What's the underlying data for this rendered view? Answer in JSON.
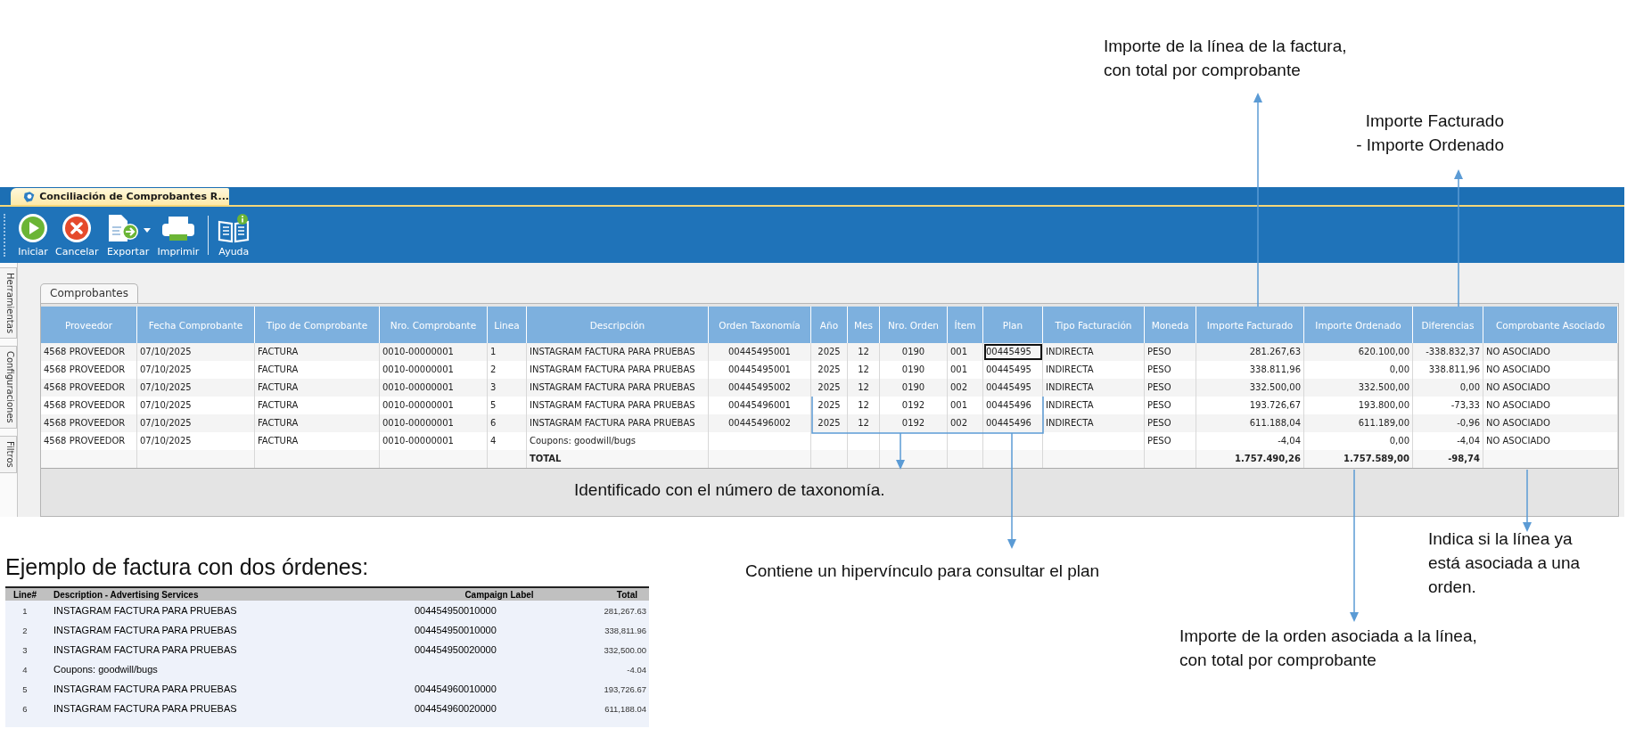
{
  "window": {
    "tab_title": "Conciliación de Comprobantes R..."
  },
  "toolbar": [
    {
      "label": "Iniciar",
      "kind": "start"
    },
    {
      "label": "Cancelar",
      "kind": "cancel"
    },
    {
      "label": "Exportar",
      "kind": "export"
    },
    {
      "label": "Imprimir",
      "kind": "print"
    },
    {
      "label": "Ayuda",
      "kind": "help"
    }
  ],
  "side_tabs": [
    "Herramientas",
    "Configuraciones",
    "Filtros"
  ],
  "tabs": [
    {
      "label": "Comprobantes",
      "selected": true
    }
  ],
  "table": {
    "columns": [
      "Proveedor",
      "Fecha Comprobante",
      "Tipo de Comprobante",
      "Nro. Comprobante",
      "Linea",
      "Descripción",
      "Orden Taxonomía",
      "Año",
      "Mes",
      "Nro. Orden",
      "Ítem",
      "Plan",
      "Tipo Facturación",
      "Moneda",
      "Importe Facturado",
      "Importe Ordenado",
      "Diferencias",
      "Comprobante Asociado"
    ],
    "rows": [
      {
        "plan_cell_focused": true,
        "proveedor": "4568 PROVEEDOR",
        "fecha": "07/10/2025",
        "tipo": "FACTURA",
        "nro": "0010-00000001",
        "linea": "1",
        "descripcion": "INSTAGRAM FACTURA PARA PRUEBAS",
        "orden_tax": "00445495001",
        "anio": "2025",
        "mes": "12",
        "nro_orden": "0190",
        "item": "001",
        "plan": "00445495",
        "tipo_fact": "INDIRECTA",
        "moneda": "PESO",
        "imp_fact": "281.267,63",
        "imp_ord": "620.100,00",
        "dif": "-338.832,37",
        "asoc": "NO ASOCIADO"
      },
      {
        "plan_cell_focused": false,
        "proveedor": "4568 PROVEEDOR",
        "fecha": "07/10/2025",
        "tipo": "FACTURA",
        "nro": "0010-00000001",
        "linea": "2",
        "descripcion": "INSTAGRAM FACTURA PARA PRUEBAS",
        "orden_tax": "00445495001",
        "anio": "2025",
        "mes": "12",
        "nro_orden": "0190",
        "item": "001",
        "plan": "00445495",
        "tipo_fact": "INDIRECTA",
        "moneda": "PESO",
        "imp_fact": "338.811,96",
        "imp_ord": "0,00",
        "dif": "338.811,96",
        "asoc": "NO ASOCIADO"
      },
      {
        "plan_cell_focused": false,
        "proveedor": "4568 PROVEEDOR",
        "fecha": "07/10/2025",
        "tipo": "FACTURA",
        "nro": "0010-00000001",
        "linea": "3",
        "descripcion": "INSTAGRAM FACTURA PARA PRUEBAS",
        "orden_tax": "00445495002",
        "anio": "2025",
        "mes": "12",
        "nro_orden": "0190",
        "item": "002",
        "plan": "00445495",
        "tipo_fact": "INDIRECTA",
        "moneda": "PESO",
        "imp_fact": "332.500,00",
        "imp_ord": "332.500,00",
        "dif": "0,00",
        "asoc": "NO ASOCIADO"
      },
      {
        "plan_cell_focused": false,
        "proveedor": "4568 PROVEEDOR",
        "fecha": "07/10/2025",
        "tipo": "FACTURA",
        "nro": "0010-00000001",
        "linea": "5",
        "descripcion": "INSTAGRAM FACTURA PARA PRUEBAS",
        "orden_tax": "00445496001",
        "anio": "2025",
        "mes": "12",
        "nro_orden": "0192",
        "item": "001",
        "plan": "00445496",
        "tipo_fact": "INDIRECTA",
        "moneda": "PESO",
        "imp_fact": "193.726,67",
        "imp_ord": "193.800,00",
        "dif": "-73,33",
        "asoc": "NO ASOCIADO"
      },
      {
        "plan_cell_focused": false,
        "proveedor": "4568 PROVEEDOR",
        "fecha": "07/10/2025",
        "tipo": "FACTURA",
        "nro": "0010-00000001",
        "linea": "6",
        "descripcion": "INSTAGRAM FACTURA PARA PRUEBAS",
        "orden_tax": "00445496002",
        "anio": "2025",
        "mes": "12",
        "nro_orden": "0192",
        "item": "002",
        "plan": "00445496",
        "tipo_fact": "INDIRECTA",
        "moneda": "PESO",
        "imp_fact": "611.188,04",
        "imp_ord": "611.189,00",
        "dif": "-0,96",
        "asoc": "NO ASOCIADO"
      },
      {
        "plan_cell_focused": false,
        "proveedor": "4568 PROVEEDOR",
        "fecha": "07/10/2025",
        "tipo": "FACTURA",
        "nro": "0010-00000001",
        "linea": "4",
        "descripcion": "Coupons: goodwill/bugs",
        "moneda": "PESO",
        "imp_fact": "-4,04",
        "imp_ord": "0,00",
        "dif": "-4,04",
        "asoc": "NO ASOCIADO"
      }
    ],
    "total_row": {
      "descripcion": "TOTAL",
      "imp_fact": "1.757.490,26",
      "imp_ord": "1.757.589,00",
      "dif": "-98,74"
    }
  },
  "annotations": [
    {
      "lines": [
        "Importe de la línea de la factura,",
        "con total por comprobante"
      ]
    },
    {
      "lines": [
        "Importe Facturado",
        "- Importe Ordenado"
      ]
    },
    {
      "lines": [
        "Identificado con el número de taxonomía."
      ]
    },
    {
      "lines": [
        "Contiene un hipervínculo para consultar el plan"
      ]
    },
    {
      "lines": [
        "Importe de la orden asociada a la línea,",
        "con total por comprobante"
      ]
    },
    {
      "lines": [
        "Indica si la línea ya",
        "está asociada a una",
        "orden."
      ]
    }
  ],
  "invoice_example": {
    "title": "Ejemplo de factura con dos órdenes:",
    "columns": [
      "Line#",
      "Description - Advertising Services",
      "Campaign Label",
      "Total"
    ],
    "rows": [
      {
        "line": "1",
        "description": "INSTAGRAM FACTURA PARA PRUEBAS",
        "campaign": "004454950010000",
        "total": "281,267.63"
      },
      {
        "line": "2",
        "description": "INSTAGRAM FACTURA PARA PRUEBAS",
        "campaign": "004454950010000",
        "total": "338,811.96"
      },
      {
        "line": "3",
        "description": "INSTAGRAM FACTURA PARA PRUEBAS",
        "campaign": "004454950020000",
        "total": "332,500.00"
      },
      {
        "line": "4",
        "description": "Coupons: goodwill/bugs",
        "total": "-4.04"
      },
      {
        "line": "5",
        "description": "INSTAGRAM FACTURA PARA PRUEBAS",
        "campaign": "004454960010000",
        "total": "193,726.67"
      },
      {
        "line": "6",
        "description": "INSTAGRAM FACTURA PARA PRUEBAS",
        "campaign": "004454960020000",
        "total": "611,188.04"
      }
    ]
  }
}
